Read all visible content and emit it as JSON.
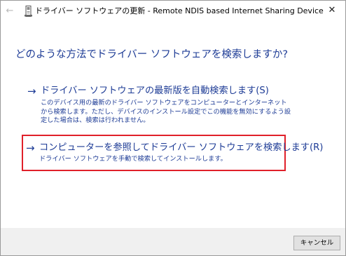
{
  "window": {
    "title": "ドライバー ソフトウェアの更新 - Remote NDIS based Internet Sharing Device",
    "back_icon": "arrow-left-icon",
    "close_label": "✕"
  },
  "main": {
    "heading": "どのような方法でドライバー ソフトウェアを検索しますか?",
    "options": [
      {
        "arrow": "→",
        "title": "ドライバー ソフトウェアの最新版を自動検索します(S)",
        "description": "このデバイス用の最新のドライバー ソフトウェアをコンピューターとインターネットから検索します。ただし、デバイスのインストール設定でこの機能を無効にするよう設定した場合は、検索は行われません。"
      },
      {
        "arrow": "→",
        "title": "コンピューターを参照してドライバー ソフトウェアを検索します(R)",
        "description": "ドライバー ソフトウェアを手動で検索してインストールします。"
      }
    ]
  },
  "footer": {
    "cancel_label": "キャンセル"
  },
  "colors": {
    "link_blue": "#1e3c96",
    "highlight_red": "#e0202a",
    "footer_bg": "#f0f0f0"
  }
}
